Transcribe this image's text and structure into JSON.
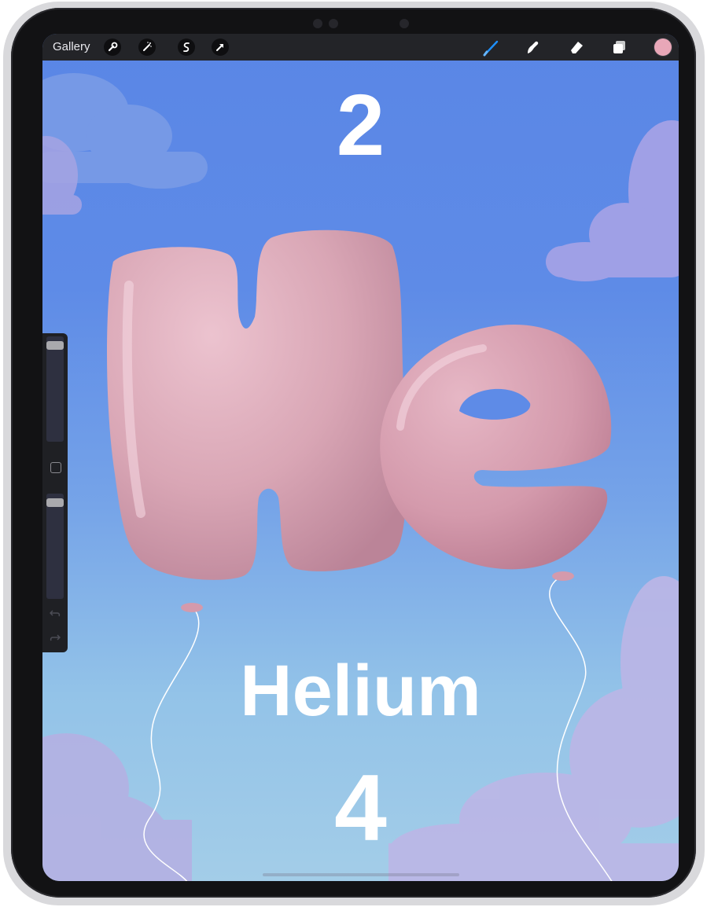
{
  "toolbar": {
    "gallery_label": "Gallery",
    "left_icons": [
      "wrench-icon",
      "magic-wand-icon",
      "selection-icon",
      "transform-arrow-icon"
    ],
    "right_icons": [
      "brush-icon",
      "smudge-icon",
      "eraser-icon",
      "layers-icon"
    ],
    "active_tool": "brush",
    "accent_color": "#1e90ff",
    "current_color": "#e8a7b8"
  },
  "artwork": {
    "atomic_number": "2",
    "symbol": "He",
    "element_name": "Helium",
    "mass_number": "4",
    "balloon_color": "#d9a6b5",
    "sky_top_color": "#5a86e6",
    "sky_bottom_color": "#a3cde8"
  },
  "sidebar": {
    "brush_size_level": 0.97,
    "opacity_level": 0.97,
    "icons": [
      "modify-square-icon",
      "undo-icon",
      "redo-icon"
    ]
  }
}
